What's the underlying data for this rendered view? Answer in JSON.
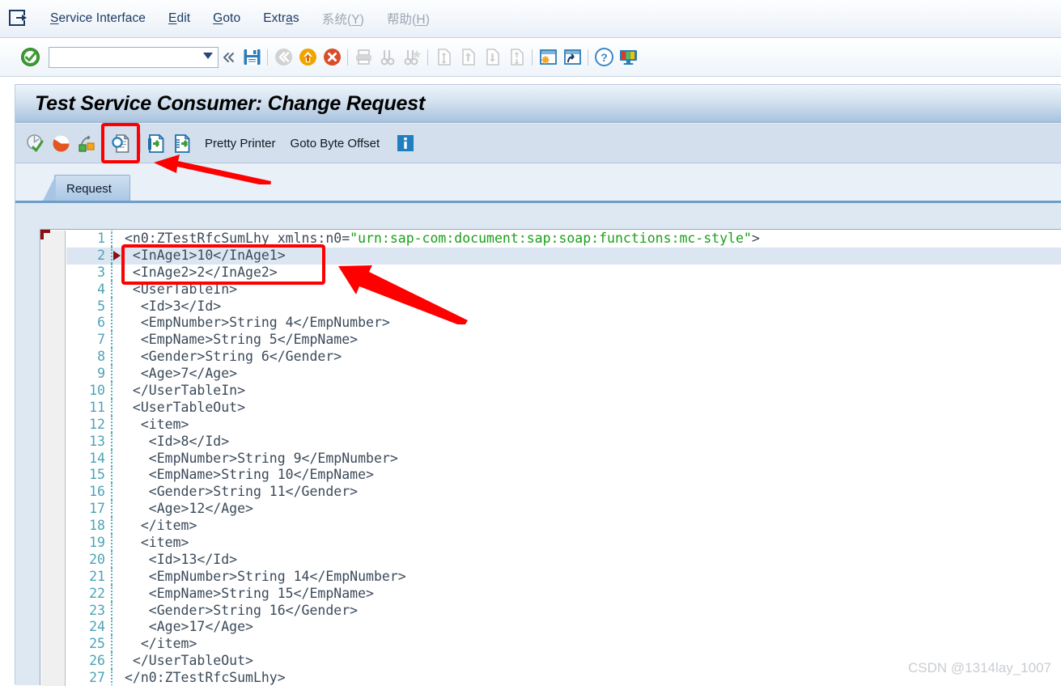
{
  "menubar": {
    "system_icon": "system-menu-icon",
    "items": [
      {
        "label": "Service Interface",
        "accel": "S",
        "disabled": false
      },
      {
        "label": "Edit",
        "accel": "E",
        "disabled": false
      },
      {
        "label": "Goto",
        "accel": "G",
        "disabled": false
      },
      {
        "label": "Extras",
        "accel": "a",
        "disabled": false
      },
      {
        "label": "系统(Y)",
        "accel": "Y",
        "disabled": true
      },
      {
        "label": "帮助(H)",
        "accel": "H",
        "disabled": true
      }
    ]
  },
  "systoolbar": {
    "enter_icon": "green-check-enter-icon",
    "command_field_value": "",
    "command_field_placeholder": "",
    "dropdown_icon": "chevron-down-icon",
    "collapse_icon": "double-chevron-left-icon",
    "icons": [
      {
        "name": "save-icon",
        "enabled": true
      },
      {
        "name": "back-icon",
        "enabled": false
      },
      {
        "name": "exit-icon",
        "enabled": true
      },
      {
        "name": "cancel-icon",
        "enabled": true
      },
      {
        "name": "print-icon",
        "enabled": false
      },
      {
        "name": "find-icon",
        "enabled": false
      },
      {
        "name": "find-next-icon",
        "enabled": false
      },
      {
        "name": "first-page-icon",
        "enabled": false
      },
      {
        "name": "previous-page-icon",
        "enabled": false
      },
      {
        "name": "next-page-icon",
        "enabled": false
      },
      {
        "name": "last-page-icon",
        "enabled": false
      },
      {
        "name": "create-session-icon",
        "enabled": true
      },
      {
        "name": "create-shortcut-icon",
        "enabled": true
      },
      {
        "name": "help-icon",
        "enabled": true
      },
      {
        "name": "customize-layout-icon",
        "enabled": true
      }
    ]
  },
  "screen": {
    "title": "Test Service Consumer: Change Request"
  },
  "apptoolbar": {
    "icons": [
      {
        "name": "check-syntax-icon"
      },
      {
        "name": "cancel-round-icon"
      },
      {
        "name": "activate-icon"
      },
      {
        "name": "display-object-icon",
        "highlighted": true
      },
      {
        "name": "import-xml-icon"
      },
      {
        "name": "export-xml-icon"
      }
    ],
    "buttons": [
      {
        "label": "Pretty Printer"
      },
      {
        "label": "Goto Byte Offset"
      }
    ],
    "info_icon": "information-icon"
  },
  "tabs": [
    {
      "label": "Request",
      "active": true
    }
  ],
  "editor": {
    "gutter_marker_line": 2,
    "highlighted_line": 2,
    "lines": [
      {
        "n": 1,
        "text": "<n0:ZTestRfcSumLhy xmlns:n0=",
        "quoted": "\"urn:sap-com:document:sap:soap:functions:mc-style\"",
        "tail": ">"
      },
      {
        "n": 2,
        "text": " <InAge1>10</InAge1>"
      },
      {
        "n": 3,
        "text": " <InAge2>2</InAge2>"
      },
      {
        "n": 4,
        "text": " <UserTableIn>"
      },
      {
        "n": 5,
        "text": "  <Id>3</Id>"
      },
      {
        "n": 6,
        "text": "  <EmpNumber>String 4</EmpNumber>"
      },
      {
        "n": 7,
        "text": "  <EmpName>String 5</EmpName>"
      },
      {
        "n": 8,
        "text": "  <Gender>String 6</Gender>"
      },
      {
        "n": 9,
        "text": "  <Age>7</Age>"
      },
      {
        "n": 10,
        "text": " </UserTableIn>"
      },
      {
        "n": 11,
        "text": " <UserTableOut>"
      },
      {
        "n": 12,
        "text": "  <item>"
      },
      {
        "n": 13,
        "text": "   <Id>8</Id>"
      },
      {
        "n": 14,
        "text": "   <EmpNumber>String 9</EmpNumber>"
      },
      {
        "n": 15,
        "text": "   <EmpName>String 10</EmpName>"
      },
      {
        "n": 16,
        "text": "   <Gender>String 11</Gender>"
      },
      {
        "n": 17,
        "text": "   <Age>12</Age>"
      },
      {
        "n": 18,
        "text": "  </item>"
      },
      {
        "n": 19,
        "text": "  <item>"
      },
      {
        "n": 20,
        "text": "   <Id>13</Id>"
      },
      {
        "n": 21,
        "text": "   <EmpNumber>String 14</EmpNumber>"
      },
      {
        "n": 22,
        "text": "   <EmpName>String 15</EmpName>"
      },
      {
        "n": 23,
        "text": "   <Gender>String 16</Gender>"
      },
      {
        "n": 24,
        "text": "   <Age>17</Age>"
      },
      {
        "n": 25,
        "text": "  </item>"
      },
      {
        "n": 26,
        "text": " </UserTableOut>"
      },
      {
        "n": 27,
        "text": "</n0:ZTestRfcSumLhy>"
      }
    ]
  },
  "annotations": {
    "color": "#fe0000",
    "boxes": [
      {
        "name": "highlight-box-display-icon"
      },
      {
        "name": "highlight-box-inage-lines"
      }
    ],
    "arrows": [
      {
        "name": "arrow-to-display-icon"
      },
      {
        "name": "arrow-to-inage-lines"
      }
    ]
  },
  "watermark": {
    "text": "CSDN @1314lay_1007"
  },
  "colors": {
    "accent_red": "#fe0000",
    "line_number": "#4ba3b5",
    "string_green": "#1aa01a",
    "code_gray": "#3b4a5a",
    "title_bar_blue": "#a9c3de",
    "selection_blue": "#dbe6f2"
  }
}
